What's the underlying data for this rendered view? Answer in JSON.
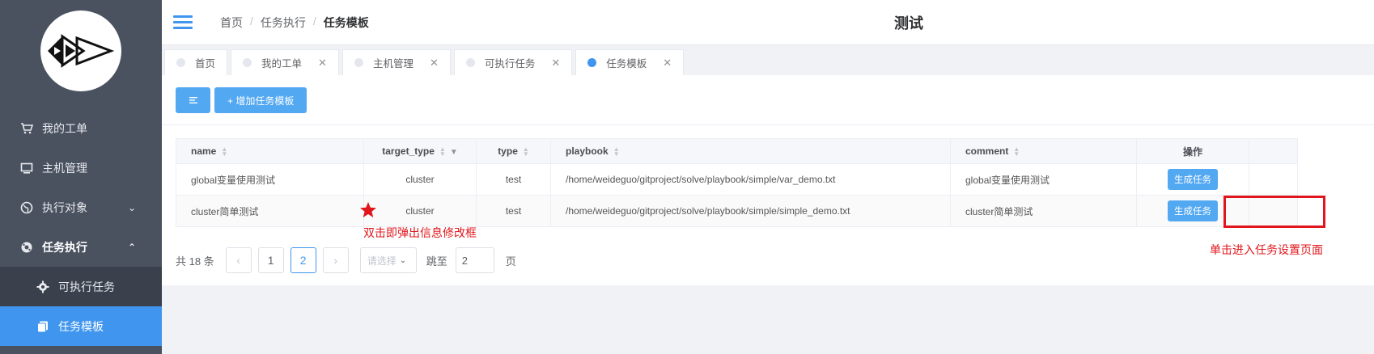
{
  "sidebar": {
    "items": [
      {
        "label": "我的工单",
        "icon": "cart-icon"
      },
      {
        "label": "主机管理",
        "icon": "monitor-icon"
      },
      {
        "label": "执行对象",
        "icon": "globe-icon",
        "arrow": "⌄"
      },
      {
        "label": "任务执行",
        "icon": "gear-cluster-icon",
        "arrow": "⌃"
      }
    ],
    "submenu": [
      {
        "label": "可执行任务",
        "icon": "gear-icon"
      },
      {
        "label": "任务模板",
        "icon": "copy-icon",
        "active": true
      }
    ]
  },
  "header": {
    "breadcrumb": [
      "首页",
      "任务执行",
      "任务模板"
    ],
    "separator": "/",
    "title": "测试"
  },
  "tabs": [
    {
      "label": "首页",
      "closable": false,
      "active": false
    },
    {
      "label": "我的工单",
      "closable": true,
      "active": false
    },
    {
      "label": "主机管理",
      "closable": true,
      "active": false
    },
    {
      "label": "可执行任务",
      "closable": true,
      "active": false
    },
    {
      "label": "任务模板",
      "closable": true,
      "active": true
    }
  ],
  "toolbar": {
    "add_label": "+ 增加任务模板"
  },
  "table": {
    "columns": [
      "name",
      "target_type",
      "type",
      "playbook",
      "comment",
      "操作"
    ],
    "rows": [
      {
        "name": "global变量使用测试",
        "target_type": "cluster",
        "type": "test",
        "playbook": "/home/weideguo/gitproject/solve/playbook/simple/var_demo.txt",
        "comment": "global变量使用测试",
        "action": "生成任务"
      },
      {
        "name": "cluster简单测试",
        "target_type": "cluster",
        "type": "test",
        "playbook": "/home/weideguo/gitproject/solve/playbook/simple/simple_demo.txt",
        "comment": "cluster简单测试",
        "action": "生成任务"
      }
    ]
  },
  "pagination": {
    "total": "共 18 条",
    "prev": "‹",
    "pages": [
      "1",
      "2"
    ],
    "current": "2",
    "next": "›",
    "page_size_placeholder": "请选择",
    "jump_label": "跳至",
    "jump_value": "2",
    "unit": "页"
  },
  "annotations": {
    "dblclick_note": "双击即弹出信息修改框",
    "click_note": "单击进入任务设置页面",
    "color": "#e0161c"
  },
  "colors": {
    "sidebar_bg": "#4a5260",
    "accent": "#4096ee",
    "button": "#53a8f2"
  }
}
